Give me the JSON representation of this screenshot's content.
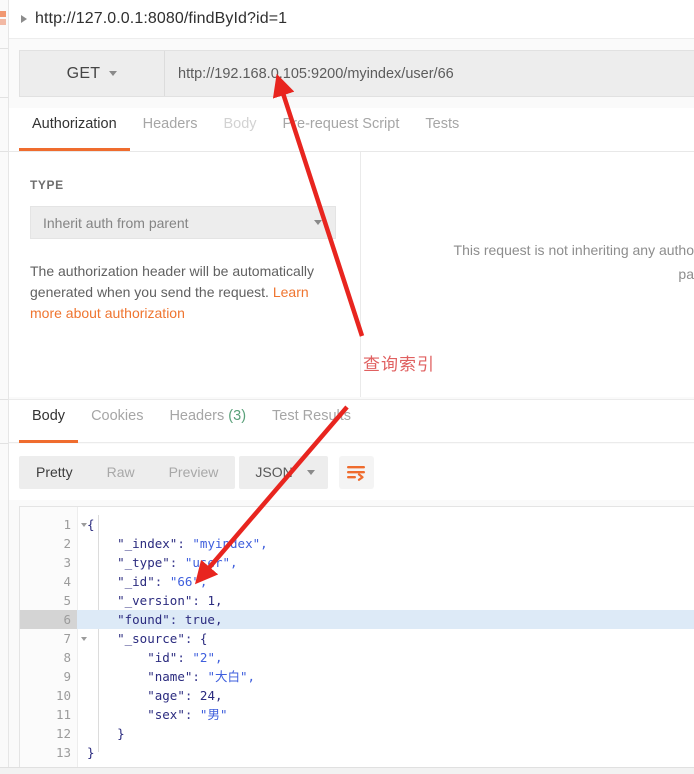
{
  "request": {
    "title": "http://127.0.0.1:8080/findById?id=1",
    "method": "GET",
    "url": "http://192.168.0.105:9200/myindex/user/66",
    "tabs": [
      {
        "label": "Authorization",
        "state": "active"
      },
      {
        "label": "Headers",
        "state": "normal"
      },
      {
        "label": "Body",
        "state": "faded"
      },
      {
        "label": "Pre-request Script",
        "state": "normal"
      },
      {
        "label": "Tests",
        "state": "normal"
      }
    ]
  },
  "authorization": {
    "type_label": "TYPE",
    "type_value": "Inherit auth from parent",
    "description_part1": "The authorization header will be automatically generated when you send the request. ",
    "link_text": "Learn more about authorization",
    "inherit_notice_line1": "This request is not inheriting any autho",
    "inherit_notice_line2": "pa"
  },
  "response": {
    "tabs": [
      {
        "label": "Body",
        "state": "active",
        "count": ""
      },
      {
        "label": "Cookies",
        "state": "normal",
        "count": ""
      },
      {
        "label": "Headers",
        "state": "normal",
        "count": "(3)"
      },
      {
        "label": "Test Results",
        "state": "normal",
        "count": ""
      }
    ],
    "view_modes": [
      {
        "label": "Pretty",
        "state": "active"
      },
      {
        "label": "Raw",
        "state": "normal"
      },
      {
        "label": "Preview",
        "state": "normal"
      }
    ],
    "format": "JSON",
    "wrap_icon": "word-wrap-icon"
  },
  "code": {
    "highlighted_line": 6,
    "lines": [
      {
        "num": "1",
        "fold": true,
        "text": "{"
      },
      {
        "num": "2",
        "fold": false,
        "text": "    \"_index\": \"myindex\","
      },
      {
        "num": "3",
        "fold": false,
        "text": "    \"_type\": \"user\","
      },
      {
        "num": "4",
        "fold": false,
        "text": "    \"_id\": \"66\","
      },
      {
        "num": "5",
        "fold": false,
        "text": "    \"_version\": 1,"
      },
      {
        "num": "6",
        "fold": false,
        "text": "    \"found\": true,"
      },
      {
        "num": "7",
        "fold": true,
        "text": "    \"_source\": {"
      },
      {
        "num": "8",
        "fold": false,
        "text": "        \"id\": \"2\","
      },
      {
        "num": "9",
        "fold": false,
        "text": "        \"name\": \"大白\","
      },
      {
        "num": "10",
        "fold": false,
        "text": "        \"age\": 24,"
      },
      {
        "num": "11",
        "fold": false,
        "text": "        \"sex\": \"男\""
      },
      {
        "num": "12",
        "fold": false,
        "text": "    }"
      },
      {
        "num": "13",
        "fold": false,
        "text": "}"
      }
    ],
    "json_object": {
      "_index": "myindex",
      "_type": "user",
      "_id": "66",
      "_version": 1,
      "found": true,
      "_source": {
        "id": "2",
        "name": "大白",
        "age": 24,
        "sex": "男"
      }
    }
  },
  "annotations": {
    "note_text": "查询索引",
    "note_color": "#e06060",
    "arrow_color": "#e8251f"
  }
}
